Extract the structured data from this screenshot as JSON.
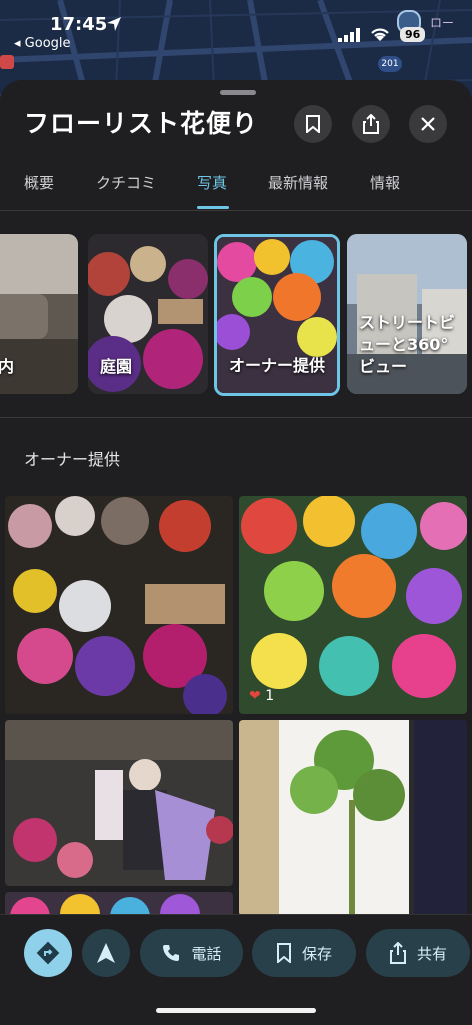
{
  "status_bar": {
    "time": "17:45",
    "battery": "96",
    "back_app": "Google"
  },
  "map": {
    "route_badge": "201",
    "place_label": "ロー"
  },
  "place": {
    "title": "フローリスト花便り"
  },
  "tabs": [
    {
      "label": "概要"
    },
    {
      "label": "クチコミ"
    },
    {
      "label": "写真",
      "active": true
    },
    {
      "label": "最新情報"
    },
    {
      "label": "情報"
    }
  ],
  "categories": [
    {
      "label": "内"
    },
    {
      "label": "庭園"
    },
    {
      "label": "オーナー提供",
      "selected": true
    },
    {
      "label": "ストリートビューと360° ビュー"
    }
  ],
  "section_title": "オーナー提供",
  "photos": {
    "like_count": "1"
  },
  "actions": {
    "call": "電話",
    "save": "保存",
    "share": "共有"
  },
  "colors": {
    "accent": "#6fc5e6",
    "sheet_bg": "#1f1f21",
    "pill_bg": "#28404a"
  }
}
